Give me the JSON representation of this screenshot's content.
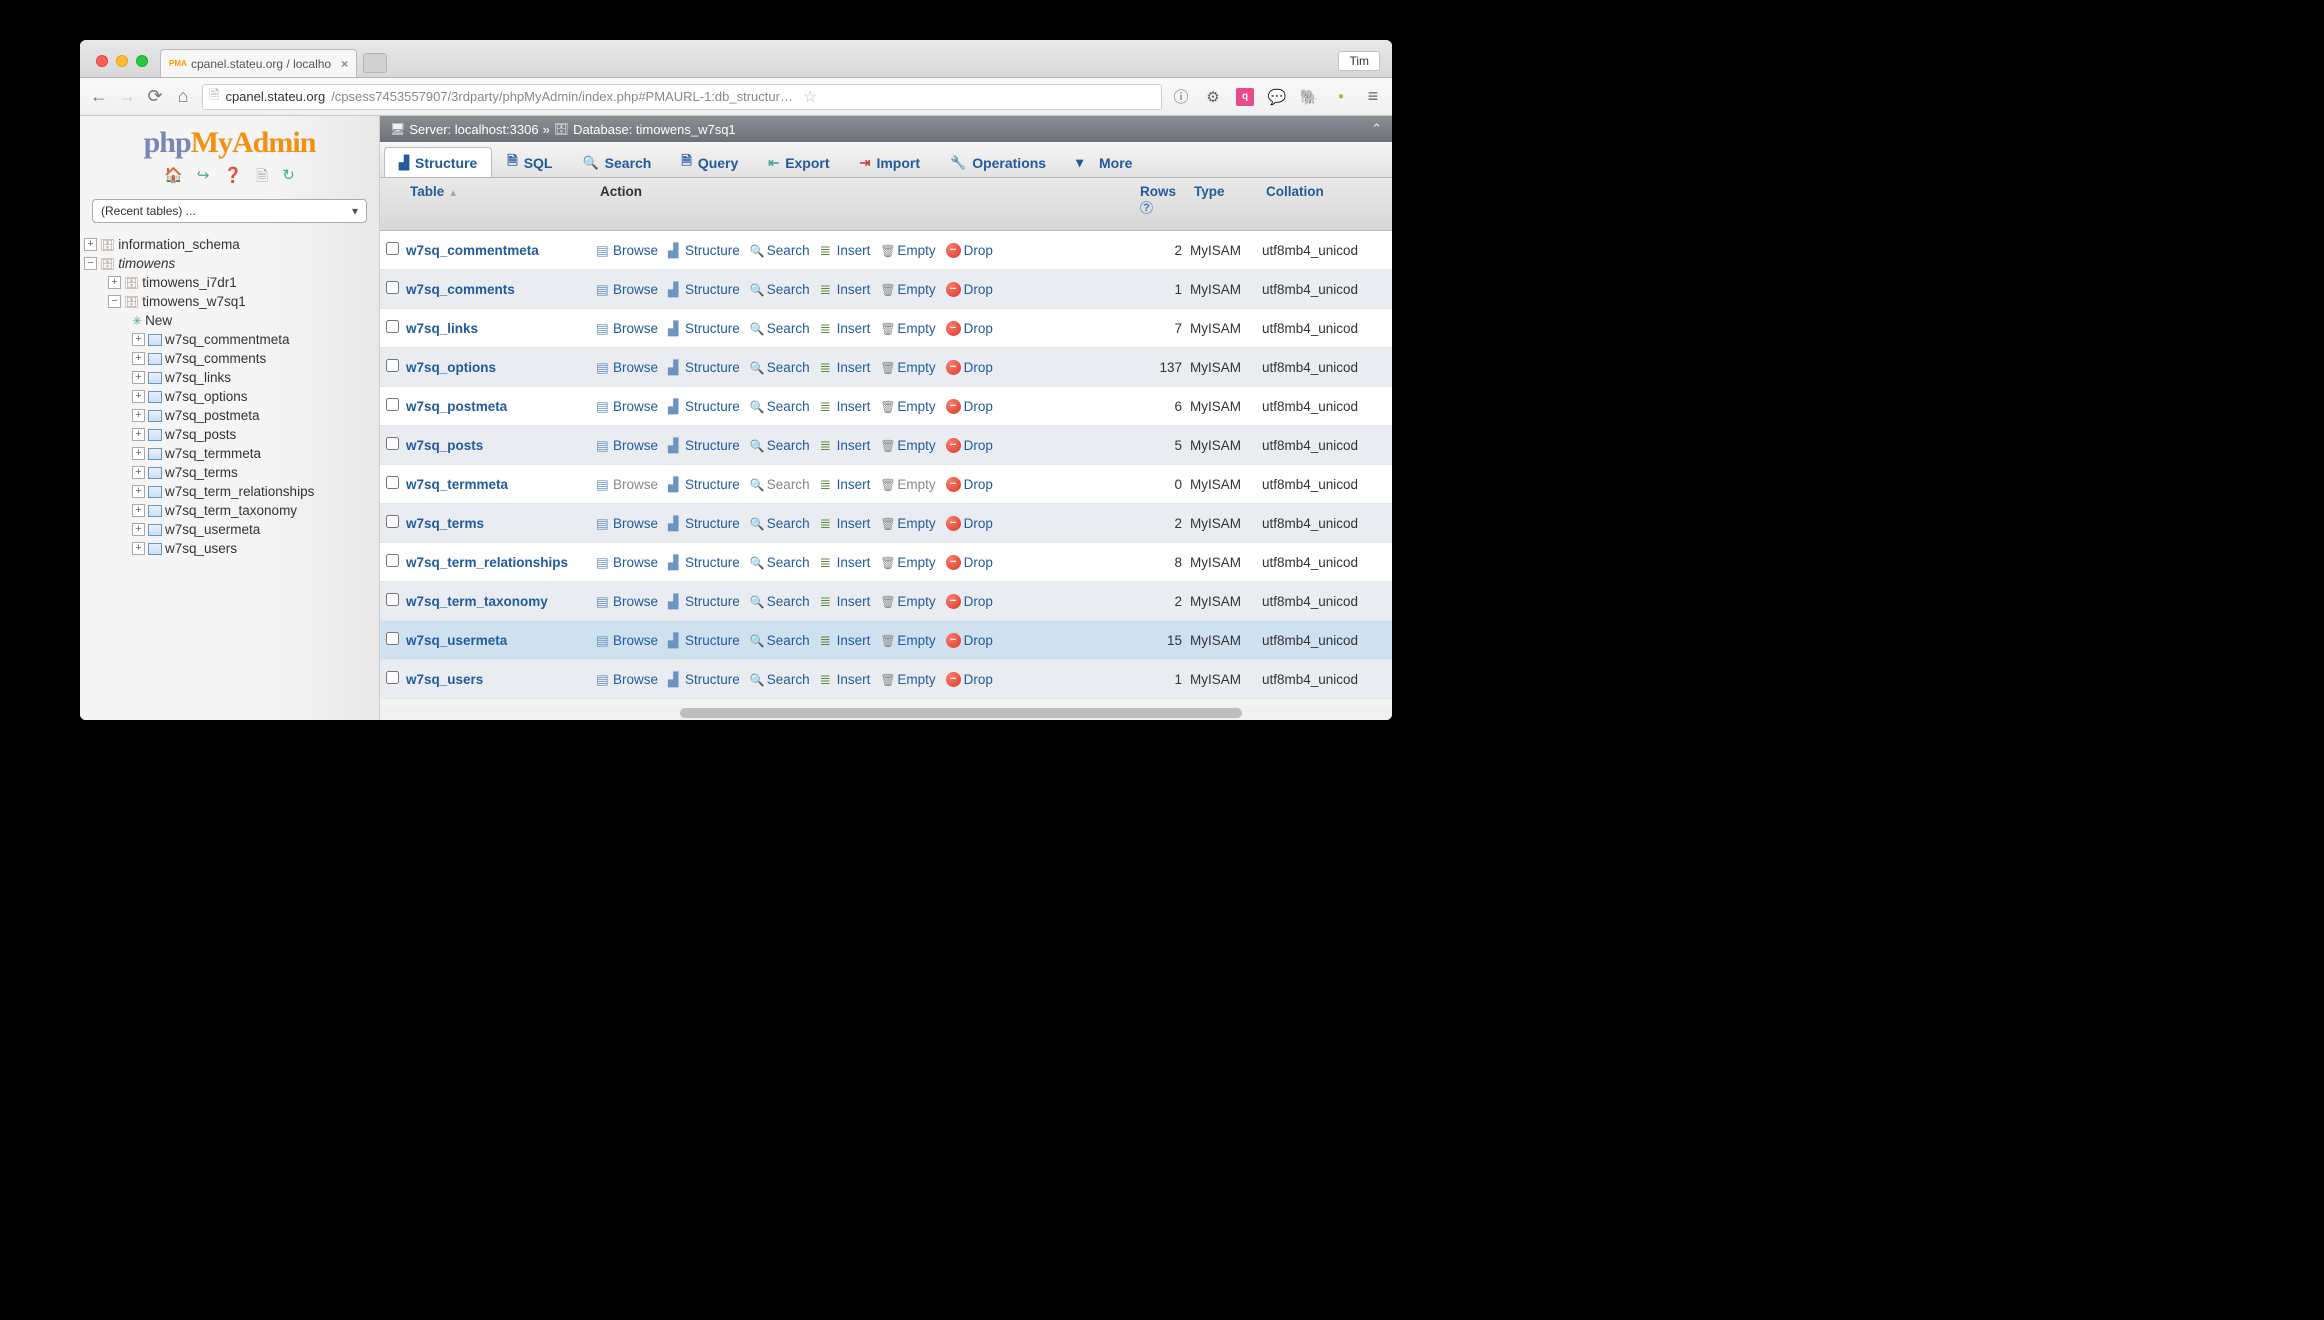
{
  "chrome": {
    "tab_title": "cpanel.stateu.org / localho",
    "user_button": "Tim",
    "url_host": "cpanel.stateu.org",
    "url_path": "/cpsess7453557907/3rdparty/phpMyAdmin/index.php#PMAURL-1:db_structur…"
  },
  "pma": {
    "recent_tables_label": "(Recent tables) ...",
    "breadcrumb": {
      "server_label": "Server: localhost:3306",
      "database_label": "Database: timowens_w7sq1",
      "separator": "»"
    },
    "tabs": [
      {
        "id": "structure",
        "label": "Structure"
      },
      {
        "id": "sql",
        "label": "SQL"
      },
      {
        "id": "search",
        "label": "Search"
      },
      {
        "id": "query",
        "label": "Query"
      },
      {
        "id": "export",
        "label": "Export"
      },
      {
        "id": "import",
        "label": "Import"
      },
      {
        "id": "operations",
        "label": "Operations"
      }
    ],
    "more_label": "More",
    "columns": {
      "table": "Table",
      "action": "Action",
      "rows": "Rows",
      "type": "Type",
      "collation": "Collation"
    },
    "actions": {
      "browse": "Browse",
      "structure": "Structure",
      "search": "Search",
      "insert": "Insert",
      "empty": "Empty",
      "drop": "Drop"
    },
    "tree": {
      "root1": "information_schema",
      "root2": "timowens",
      "db1": "timowens_i7dr1",
      "db2": "timowens_w7sq1",
      "new_label": "New",
      "tables": [
        "w7sq_commentmeta",
        "w7sq_comments",
        "w7sq_links",
        "w7sq_options",
        "w7sq_postmeta",
        "w7sq_posts",
        "w7sq_termmeta",
        "w7sq_terms",
        "w7sq_term_relationships",
        "w7sq_term_taxonomy",
        "w7sq_usermeta",
        "w7sq_users"
      ]
    },
    "rows": [
      {
        "name": "w7sq_commentmeta",
        "rows": 2,
        "type": "MyISAM",
        "collation": "utf8mb4_unicod",
        "dim": false
      },
      {
        "name": "w7sq_comments",
        "rows": 1,
        "type": "MyISAM",
        "collation": "utf8mb4_unicod",
        "dim": false
      },
      {
        "name": "w7sq_links",
        "rows": 7,
        "type": "MyISAM",
        "collation": "utf8mb4_unicod",
        "dim": false
      },
      {
        "name": "w7sq_options",
        "rows": 137,
        "type": "MyISAM",
        "collation": "utf8mb4_unicod",
        "dim": false
      },
      {
        "name": "w7sq_postmeta",
        "rows": 6,
        "type": "MyISAM",
        "collation": "utf8mb4_unicod",
        "dim": false
      },
      {
        "name": "w7sq_posts",
        "rows": 5,
        "type": "MyISAM",
        "collation": "utf8mb4_unicod",
        "dim": false
      },
      {
        "name": "w7sq_termmeta",
        "rows": 0,
        "type": "MyISAM",
        "collation": "utf8mb4_unicod",
        "dim": true
      },
      {
        "name": "w7sq_terms",
        "rows": 2,
        "type": "MyISAM",
        "collation": "utf8mb4_unicod",
        "dim": false
      },
      {
        "name": "w7sq_term_relationships",
        "rows": 8,
        "type": "MyISAM",
        "collation": "utf8mb4_unicod",
        "dim": false
      },
      {
        "name": "w7sq_term_taxonomy",
        "rows": 2,
        "type": "MyISAM",
        "collation": "utf8mb4_unicod",
        "dim": false
      },
      {
        "name": "w7sq_usermeta",
        "rows": 15,
        "type": "MyISAM",
        "collation": "utf8mb4_unicod",
        "dim": false,
        "hover": true
      },
      {
        "name": "w7sq_users",
        "rows": 1,
        "type": "MyISAM",
        "collation": "utf8mb4_unicod",
        "dim": false
      }
    ]
  }
}
